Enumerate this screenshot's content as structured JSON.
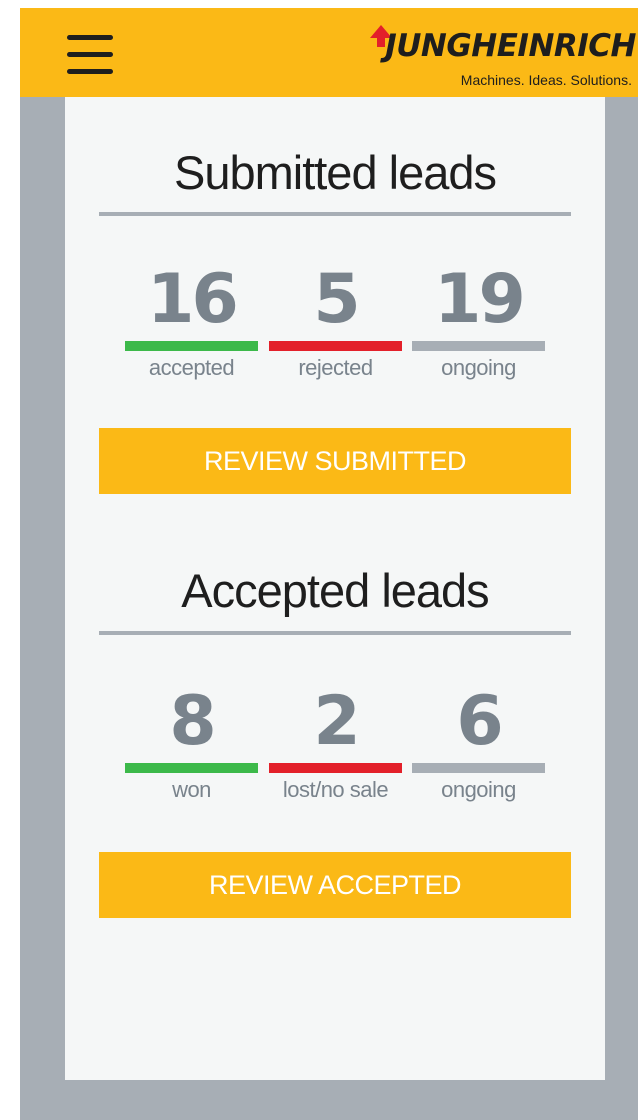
{
  "brand": {
    "name": "JUNGHEINRICH",
    "tagline": "Machines. Ideas. Solutions.",
    "header_color": "#fbb916",
    "arrow_color": "#e3202a"
  },
  "colors": {
    "green": "#3cb94a",
    "red": "#e3202a",
    "gray": "#a7aeb5",
    "number": "#79838c"
  },
  "submitted": {
    "title": "Submitted leads",
    "stats": [
      {
        "value": "16",
        "label": "accepted",
        "color": "green"
      },
      {
        "value": "5",
        "label": "rejected",
        "color": "red"
      },
      {
        "value": "19",
        "label": "ongoing",
        "color": "gray"
      }
    ],
    "button_label": "REVIEW SUBMITTED"
  },
  "accepted": {
    "title": "Accepted leads",
    "stats": [
      {
        "value": "8",
        "label": "won",
        "color": "green"
      },
      {
        "value": "2",
        "label": "lost/no sale",
        "color": "red"
      },
      {
        "value": "6",
        "label": "ongoing",
        "color": "gray"
      }
    ],
    "button_label": "REVIEW ACCEPTED"
  }
}
